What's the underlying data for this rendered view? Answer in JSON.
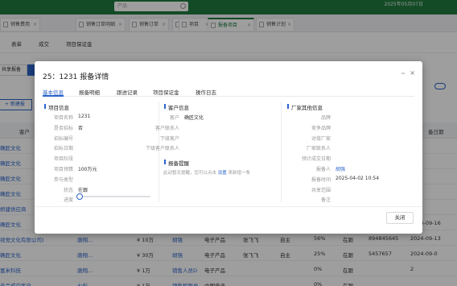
{
  "topbar": {
    "search_text": "产品",
    "date": "2025年05月07日"
  },
  "tabs": [
    "销售费用",
    "销售订单明细",
    "销售订单",
    "报价",
    "项目",
    "报备项目",
    "销售计划"
  ],
  "subnav": [
    "表单",
    "成交",
    "项目保证金"
  ],
  "toolbar": {
    "share_label": "共享报备",
    "new_label": "+ 新建报"
  },
  "grid": {
    "headers": [
      "客户",
      "备日期"
    ],
    "rows": [
      {
        "customer": "确匠文化"
      },
      {
        "customer": "确匠文化"
      },
      {
        "customer": "确匠文化"
      },
      {
        "customer": "确匠文化"
      },
      {
        "customer": "桥建供应商"
      },
      {
        "customer": "确匠文化",
        "date": "2024-09-16"
      },
      {
        "customer": "视觉文化有限公司)",
        "c2": "唐翔...",
        "amount": "¥ 10万",
        "person": "胡强",
        "product": "电子产品",
        "contact": "张飞飞",
        "type": "自主",
        "pct": "56%",
        "status": "在跟",
        "code": "894845645",
        "date": "2024-09-13"
      },
      {
        "customer": "确匠文化",
        "c2": "唐翔...",
        "amount": "¥ 30万",
        "person": "胡强",
        "product": "电子产品",
        "contact": "张飞飞",
        "type": "自主",
        "pct": "25%",
        "status": "在跟",
        "code": "5457657",
        "date": "2024-09-0"
      },
      {
        "customer": "富米科技",
        "c2": "唐翔...",
        "amount": "¥ 1万",
        "person": "销售人员D",
        "product": "电子产品",
        "pct": "0%",
        "status": "在跟",
        "date": "2"
      },
      {
        "customer": "产品成交客户",
        "c2": "七彩...",
        "amount": "¥ 1万",
        "person": "销售权限员",
        "product": "中国电子",
        "pct": "0%",
        "status": "在跟"
      }
    ]
  },
  "modal": {
    "title": "25：1231 报备详情",
    "more_icon": "···",
    "close_icon": "×",
    "tabs": [
      "基本信息",
      "报备明细",
      "跟进记录",
      "项目保证金",
      "操作日志"
    ],
    "project_info": {
      "heading": "项目信息",
      "fields": [
        {
          "label": "项目名称",
          "value": "1231"
        },
        {
          "label": "是否招标",
          "value": "否"
        },
        {
          "label": "招标编号",
          "value": ""
        },
        {
          "label": "招标日期",
          "value": ""
        },
        {
          "label": "项目阶段",
          "value": ""
        },
        {
          "label": "项目预算",
          "value": "100万元"
        },
        {
          "label": "参与类型",
          "value": ""
        },
        {
          "label": "状态",
          "value": "在跟"
        },
        {
          "label": "进度",
          "value": ""
        }
      ],
      "progress": 0
    },
    "customer_info": {
      "heading": "客户信息",
      "fields": [
        {
          "label": "客户",
          "value": "确匠文化"
        },
        {
          "label": "客户联系人",
          "value": ""
        },
        {
          "label": "下级客户",
          "value": ""
        },
        {
          "label": "下级客户联系人",
          "value": ""
        }
      ]
    },
    "reminder": {
      "heading": "报备提醒",
      "text": "此动暂无提醒，您可以点击",
      "link": "设置",
      "tail": "来新增一条"
    },
    "vendor_info": {
      "heading": "厂家其他信息",
      "fields": [
        {
          "label": "品牌",
          "value": ""
        },
        {
          "label": "竞争品牌",
          "value": ""
        },
        {
          "label": "对接厂家",
          "value": ""
        },
        {
          "label": "厂家联系人",
          "value": ""
        },
        {
          "label": "预计成交日期",
          "value": ""
        },
        {
          "label": "报备人",
          "value": "胡强"
        },
        {
          "label": "报备时间",
          "value": "2025-04-02 10:54"
        },
        {
          "label": "共享范围",
          "value": ""
        },
        {
          "label": "备注",
          "value": ""
        }
      ]
    },
    "close_button": "关闭"
  }
}
